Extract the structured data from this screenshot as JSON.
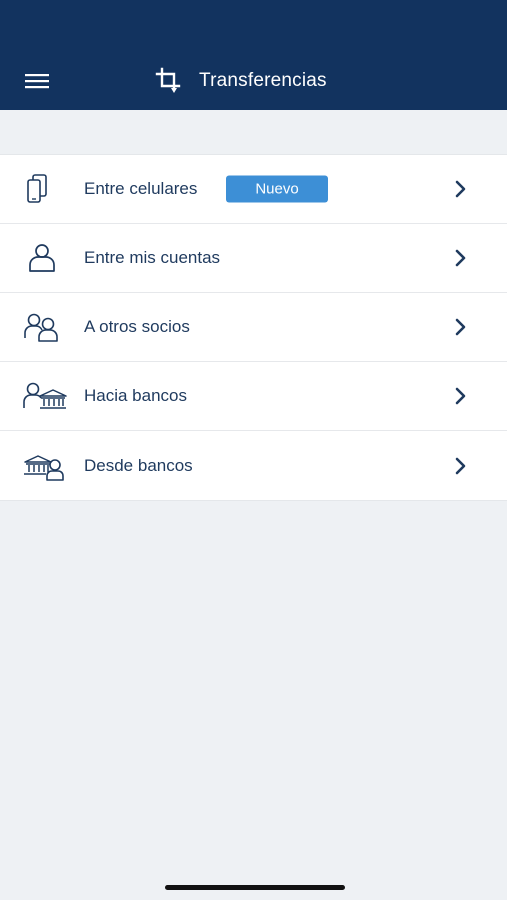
{
  "header": {
    "title": "Transferencias",
    "icons": {
      "menu": "hamburger-menu-icon",
      "title": "transfer-crop-icon"
    },
    "background": "#12335f"
  },
  "items": [
    {
      "label": "Entre celulares",
      "icon": "mobile-phones-icon",
      "badge": "Nuevo"
    },
    {
      "label": "Entre mis cuentas",
      "icon": "person-icon"
    },
    {
      "label": "A otros socios",
      "icon": "two-people-icon"
    },
    {
      "label": "Hacia bancos",
      "icon": "person-to-bank-icon"
    },
    {
      "label": "Desde bancos",
      "icon": "bank-to-person-icon"
    }
  ],
  "colors": {
    "accent": "#3d8fd6",
    "text": "#1f3a5e",
    "background": "#eef1f4"
  }
}
